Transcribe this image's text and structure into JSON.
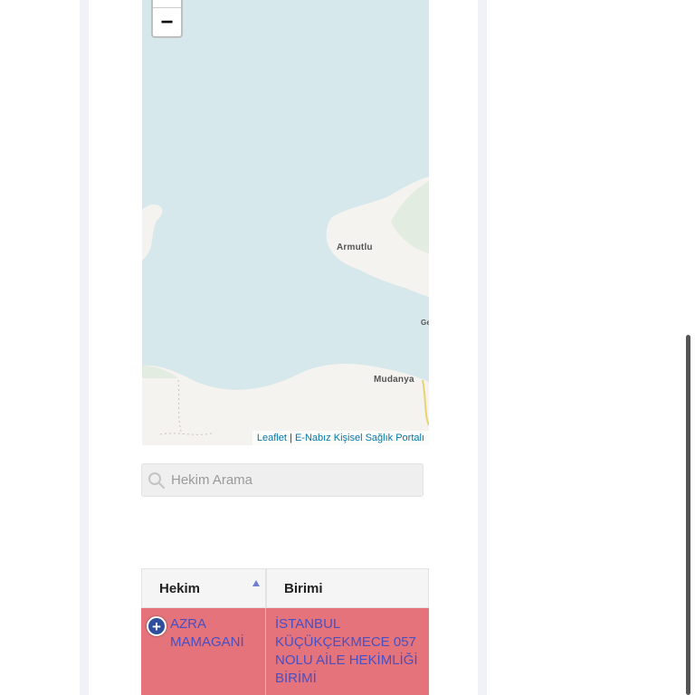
{
  "map": {
    "zoom_out_label": "−",
    "places": {
      "armutlu": "Armutlu",
      "mudanya": "Mudanya",
      "edge": "Ge"
    },
    "attribution": {
      "leaflet": "Leaflet",
      "separator": " | ",
      "portal": "E-Nabız Kişisel Sağlık Portalı"
    },
    "colors": {
      "water": "#d6e8ec",
      "land": "#f4f3ef"
    }
  },
  "search": {
    "placeholder": "Hekim Arama",
    "value": ""
  },
  "table": {
    "columns": [
      "Hekim",
      "Birimi"
    ],
    "rows": [
      {
        "hekim": "AZRA MAMAGANİ",
        "birimi": "İSTANBUL KÜÇÜKÇEKMECE 057 NOLU AİLE HEKİMLİĞİ BİRİMİ"
      }
    ],
    "expand_icon": "+",
    "row_color": "#e4737b",
    "text_color": "#4a4fbf"
  }
}
